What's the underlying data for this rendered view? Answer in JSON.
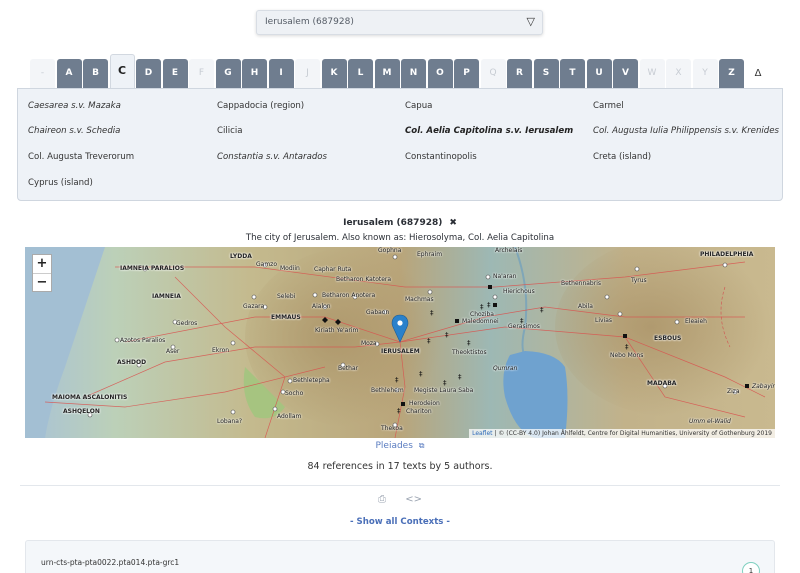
{
  "select": {
    "value": "Ierusalem (687928)"
  },
  "letters": [
    {
      "label": "-",
      "state": "disabled"
    },
    {
      "label": "A",
      "state": "enabled"
    },
    {
      "label": "B",
      "state": "enabled"
    },
    {
      "label": "C",
      "state": "active"
    },
    {
      "label": "D",
      "state": "enabled"
    },
    {
      "label": "E",
      "state": "enabled"
    },
    {
      "label": "F",
      "state": "disabled"
    },
    {
      "label": "G",
      "state": "enabled"
    },
    {
      "label": "H",
      "state": "enabled"
    },
    {
      "label": "I",
      "state": "enabled"
    },
    {
      "label": "J",
      "state": "disabled"
    },
    {
      "label": "K",
      "state": "enabled"
    },
    {
      "label": "L",
      "state": "enabled"
    },
    {
      "label": "M",
      "state": "enabled"
    },
    {
      "label": "N",
      "state": "enabled"
    },
    {
      "label": "O",
      "state": "enabled"
    },
    {
      "label": "P",
      "state": "enabled"
    },
    {
      "label": "Q",
      "state": "disabled"
    },
    {
      "label": "R",
      "state": "enabled"
    },
    {
      "label": "S",
      "state": "enabled"
    },
    {
      "label": "T",
      "state": "enabled"
    },
    {
      "label": "U",
      "state": "enabled"
    },
    {
      "label": "V",
      "state": "enabled"
    },
    {
      "label": "W",
      "state": "disabled"
    },
    {
      "label": "X",
      "state": "disabled"
    },
    {
      "label": "Y",
      "state": "disabled"
    },
    {
      "label": "Z",
      "state": "enabled"
    },
    {
      "label": "Δ",
      "state": "plain"
    }
  ],
  "entries": [
    {
      "label": "Caesarea s.v. Mazaka",
      "style": "italic"
    },
    {
      "label": "Cappadocia (region)",
      "style": "normal"
    },
    {
      "label": "Capua",
      "style": "normal"
    },
    {
      "label": "Carmel",
      "style": "normal"
    },
    {
      "label": "Chaireon s.v. Schedia",
      "style": "italic"
    },
    {
      "label": "Cilicia",
      "style": "normal"
    },
    {
      "label": "Col. Aelia Capitolina s.v. Ierusalem",
      "style": "bold"
    },
    {
      "label": "Col. Augusta Iulia Philippensis s.v. Krenides",
      "style": "italic"
    },
    {
      "label": "Col. Augusta Treverorum",
      "style": "normal"
    },
    {
      "label": "Constantia s.v. Antarados",
      "style": "italic"
    },
    {
      "label": "Constantinopolis",
      "style": "normal"
    },
    {
      "label": "Creta (island)",
      "style": "normal"
    },
    {
      "label": "Cyprus (island)",
      "style": "normal"
    }
  ],
  "place": {
    "title": "Ierusalem (687928)",
    "close": "✖",
    "description": "The city of Jerusalem. Also known as: Hierosolyma, Col. Aelia Capitolina"
  },
  "map": {
    "zoom_in": "+",
    "zoom_out": "−",
    "attribution_leaflet": "Leaflet",
    "attribution_text": " | © (CC-BY 4.0) Johan Åhlfeldt, Centre for Digital Humanities, University of Gothenburg 2019",
    "labels": [
      "IAMNEIA PARALIOS",
      "LYDDA",
      "Gamzo",
      "Modiin",
      "Caphar Ruta",
      "Gophna",
      "Ephraim",
      "Archelais",
      "PHILADELPHEIA",
      "Betharon Katotera",
      "Na'aran",
      "Tyrus",
      "Bethennabris",
      "IAMNEIA",
      "Selebi",
      "Betharon Anotera",
      "Machmas",
      "Hierichous",
      "Gazara",
      "Aialon",
      "Gabaon",
      "Abila",
      "Livias",
      "EMMAUS",
      "Gedros",
      "Kiriath Ye'arim",
      "Choziba",
      "Maledomnei",
      "Gerasimos",
      "Eleaieh",
      "Azotos Paralios",
      "Moza",
      "ESBOUS",
      "Aser",
      "Ekron",
      "IERUSALEM",
      "Theoktistos",
      "Nebo Mons",
      "ASHDOD",
      "Bethar",
      "Qumran",
      "Bethletepha",
      "MADABA",
      "MAIOMA ASCALONITIS",
      "Socho",
      "Bethlehem",
      "Megiste Laura Saba",
      "Ziza",
      "Zabayir",
      "ASHQELON",
      "Herodeion",
      "Chariton",
      "Adollam",
      "Lobana?",
      "Thekoa",
      "Umm el-Walid"
    ]
  },
  "pleiades": {
    "label": "Pleiades",
    "icon": "external-link-icon"
  },
  "summary": "84 references in 17 texts by 5 authors.",
  "actions": {
    "print_icon": "print-icon",
    "code_icon": "code-icon"
  },
  "show_all": "- Show all Contexts -",
  "card": {
    "urn": "urn-cts-pta-pta0022.pta014.pta-grc1",
    "count": "1"
  },
  "colors": {
    "tab": "#6f7d8f",
    "accent": "#4a6fb8",
    "panel": "#eef2f7"
  }
}
